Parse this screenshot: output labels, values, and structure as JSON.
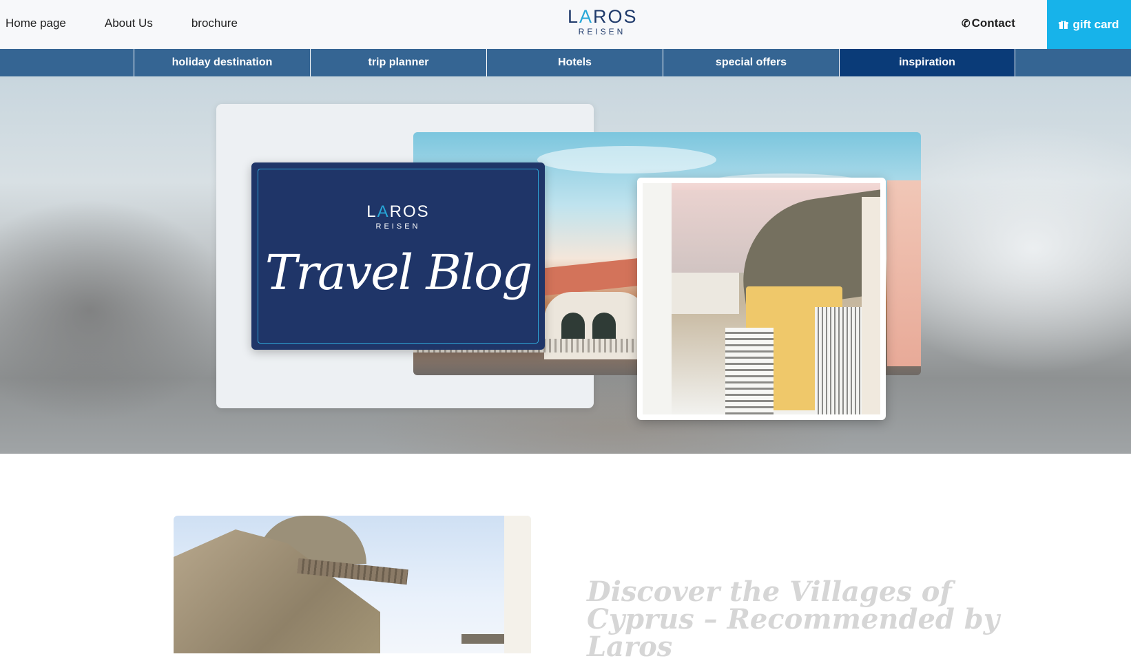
{
  "topnav": {
    "home": "Home page",
    "about": "About Us",
    "brochure": "brochure"
  },
  "brand": {
    "word_prefix": "L",
    "word_star": "A",
    "word_suffix": "ROS",
    "sub": "REISEN"
  },
  "contact": {
    "icon": "phone-icon",
    "label": "Contact"
  },
  "giftcard": {
    "icon": "gift-icon",
    "label": "gift card"
  },
  "mainnav": {
    "items": [
      {
        "label": "holiday destination"
      },
      {
        "label": "trip planner"
      },
      {
        "label": "Hotels"
      },
      {
        "label": "special offers"
      },
      {
        "label": "inspiration"
      }
    ],
    "active": "inspiration"
  },
  "hero": {
    "card_brand_prefix": "L",
    "card_brand_star": "A",
    "card_brand_suffix": "ROS",
    "card_brand_sub": "REISEN",
    "script_title": "Travel Blog"
  },
  "article": {
    "title": "Discover the Villages of Cyprus – Recommended by Laros"
  },
  "colors": {
    "nav_bg": "#356593",
    "nav_active": "#0a3b78",
    "gift_bg": "#17b3ea",
    "brand_navy": "#1f3568",
    "accent_star": "#27a7d8"
  }
}
